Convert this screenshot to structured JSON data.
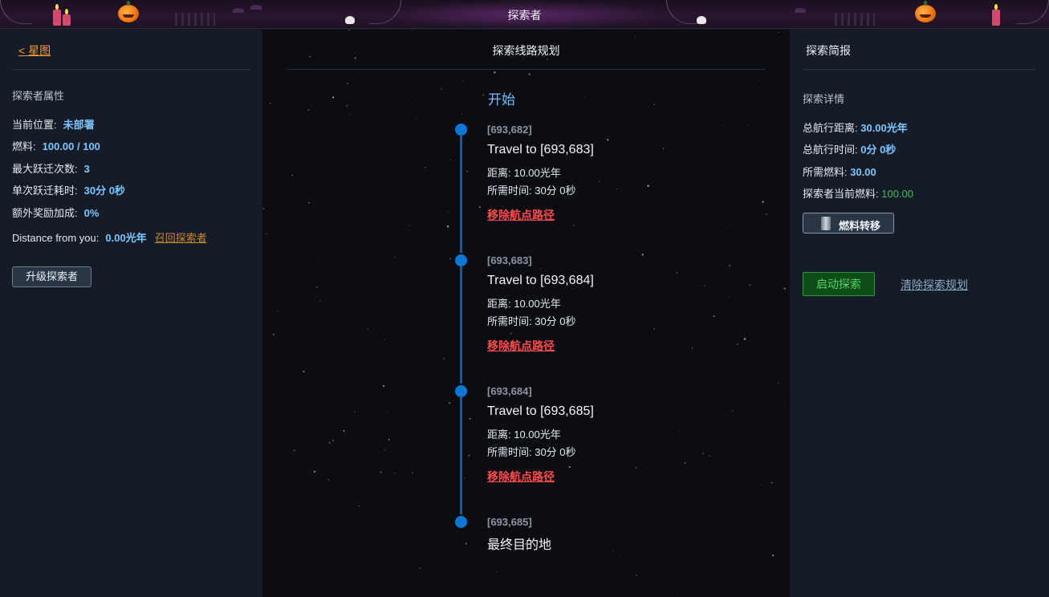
{
  "header": {
    "title": "探索者"
  },
  "left": {
    "back_link": "< 星图",
    "section_title": "探索者属性",
    "props": [
      {
        "label": "当前位置:",
        "value": "未部署"
      },
      {
        "label": "燃料:",
        "value": "100.00 / 100"
      },
      {
        "label": "最大跃迁次数:",
        "value": "3"
      },
      {
        "label": "单次跃迁耗时:",
        "value": "30分 0秒"
      },
      {
        "label": "额外奖励加成:",
        "value": "0%"
      }
    ],
    "distance": {
      "label": "Distance from you:",
      "value": "0.00光年",
      "recall": "召回探索者"
    },
    "upgrade_button": "升级探索者"
  },
  "middle": {
    "title": "探索线路规划",
    "start_label": "开始",
    "waypoints": [
      {
        "coord": "[693,682]",
        "travel": "Travel to [693,683]",
        "distance": "距离: 10.00光年",
        "time": "所需时间: 30分 0秒",
        "remove": "移除航点路径"
      },
      {
        "coord": "[693,683]",
        "travel": "Travel to [693,684]",
        "distance": "距离: 10.00光年",
        "time": "所需时间: 30分 0秒",
        "remove": "移除航点路径"
      },
      {
        "coord": "[693,684]",
        "travel": "Travel to [693,685]",
        "distance": "距离: 10.00光年",
        "time": "所需时间: 30分 0秒",
        "remove": "移除航点路径"
      }
    ],
    "final": {
      "coord": "[693,685]",
      "label": "最终目的地"
    }
  },
  "right": {
    "title": "探索简报",
    "section_title": "探索详情",
    "details": [
      {
        "label": "总航行距离: ",
        "value": "30.00光年"
      },
      {
        "label": "总航行时间: ",
        "value": "0分 0秒"
      },
      {
        "label": "所需燃料: ",
        "value": "30.00"
      },
      {
        "label": "探索者当前燃料: ",
        "value": "100.00"
      }
    ],
    "fuel_button": "燃料转移",
    "start_button": "启动探索",
    "clear_link": "清除探索规划"
  },
  "colors": {
    "accent_blue": "#7cc6ff",
    "timeline_dot": "#0a78d4",
    "remove_red": "#ff4c4c",
    "start_green": "#54d26a",
    "back_orange": "#f39c32"
  }
}
